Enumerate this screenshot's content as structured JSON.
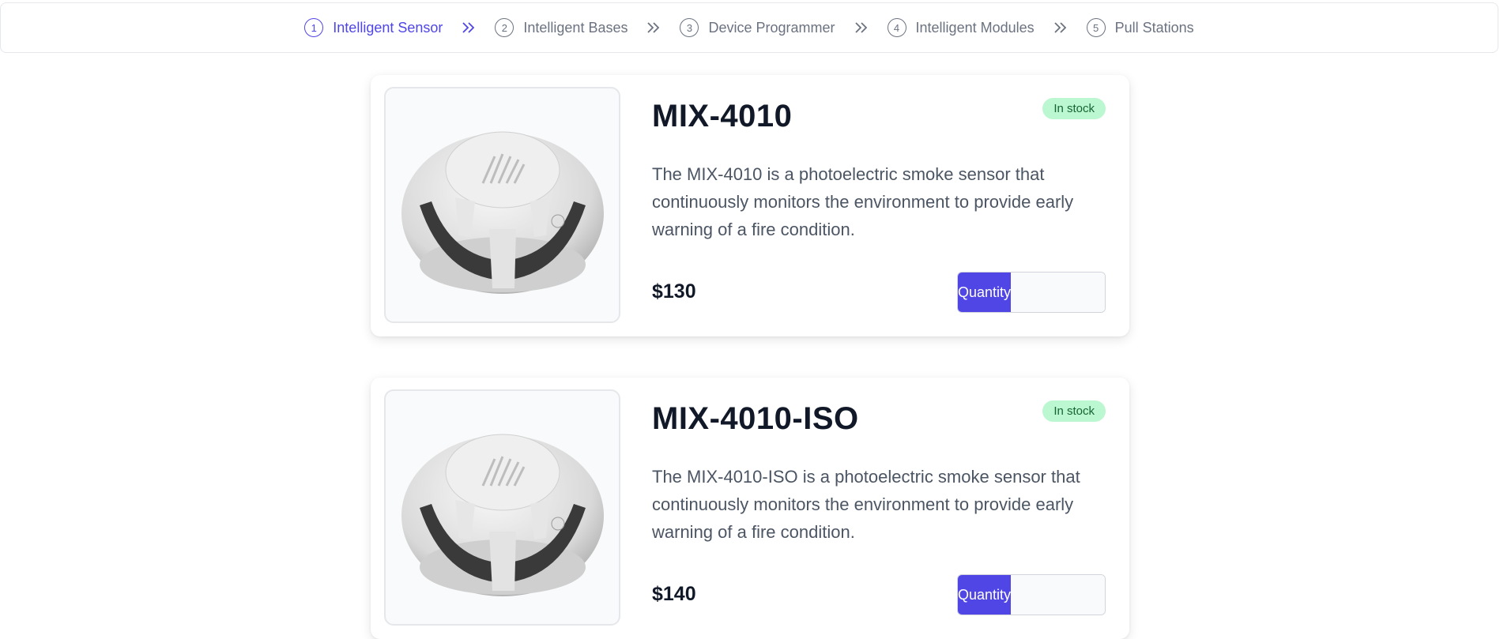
{
  "stepper": {
    "steps": [
      {
        "num": "1",
        "label": "Intelligent Sensor"
      },
      {
        "num": "2",
        "label": "Intelligent Bases"
      },
      {
        "num": "3",
        "label": "Device Programmer"
      },
      {
        "num": "4",
        "label": "Intelligent Modules"
      },
      {
        "num": "5",
        "label": "Pull Stations"
      }
    ]
  },
  "products": [
    {
      "name": "MIX-4010",
      "stock": "In stock",
      "description": "The MIX-4010 is a photoelectric smoke sensor that continuously monitors the environment to provide early warning of a fire condition.",
      "price": "$130",
      "quantity_label": "Quantity",
      "quantity_value": ""
    },
    {
      "name": "MIX-4010-ISO",
      "stock": "In stock",
      "description": "The MIX-4010-ISO is a photoelectric smoke sensor that continuously monitors the environment to provide early warning of a fire condition.",
      "price": "$140",
      "quantity_label": "Quantity",
      "quantity_value": ""
    }
  ],
  "colors": {
    "accent": "#4f46e5",
    "badge_bg": "#bbf7d0",
    "badge_text": "#166534"
  }
}
